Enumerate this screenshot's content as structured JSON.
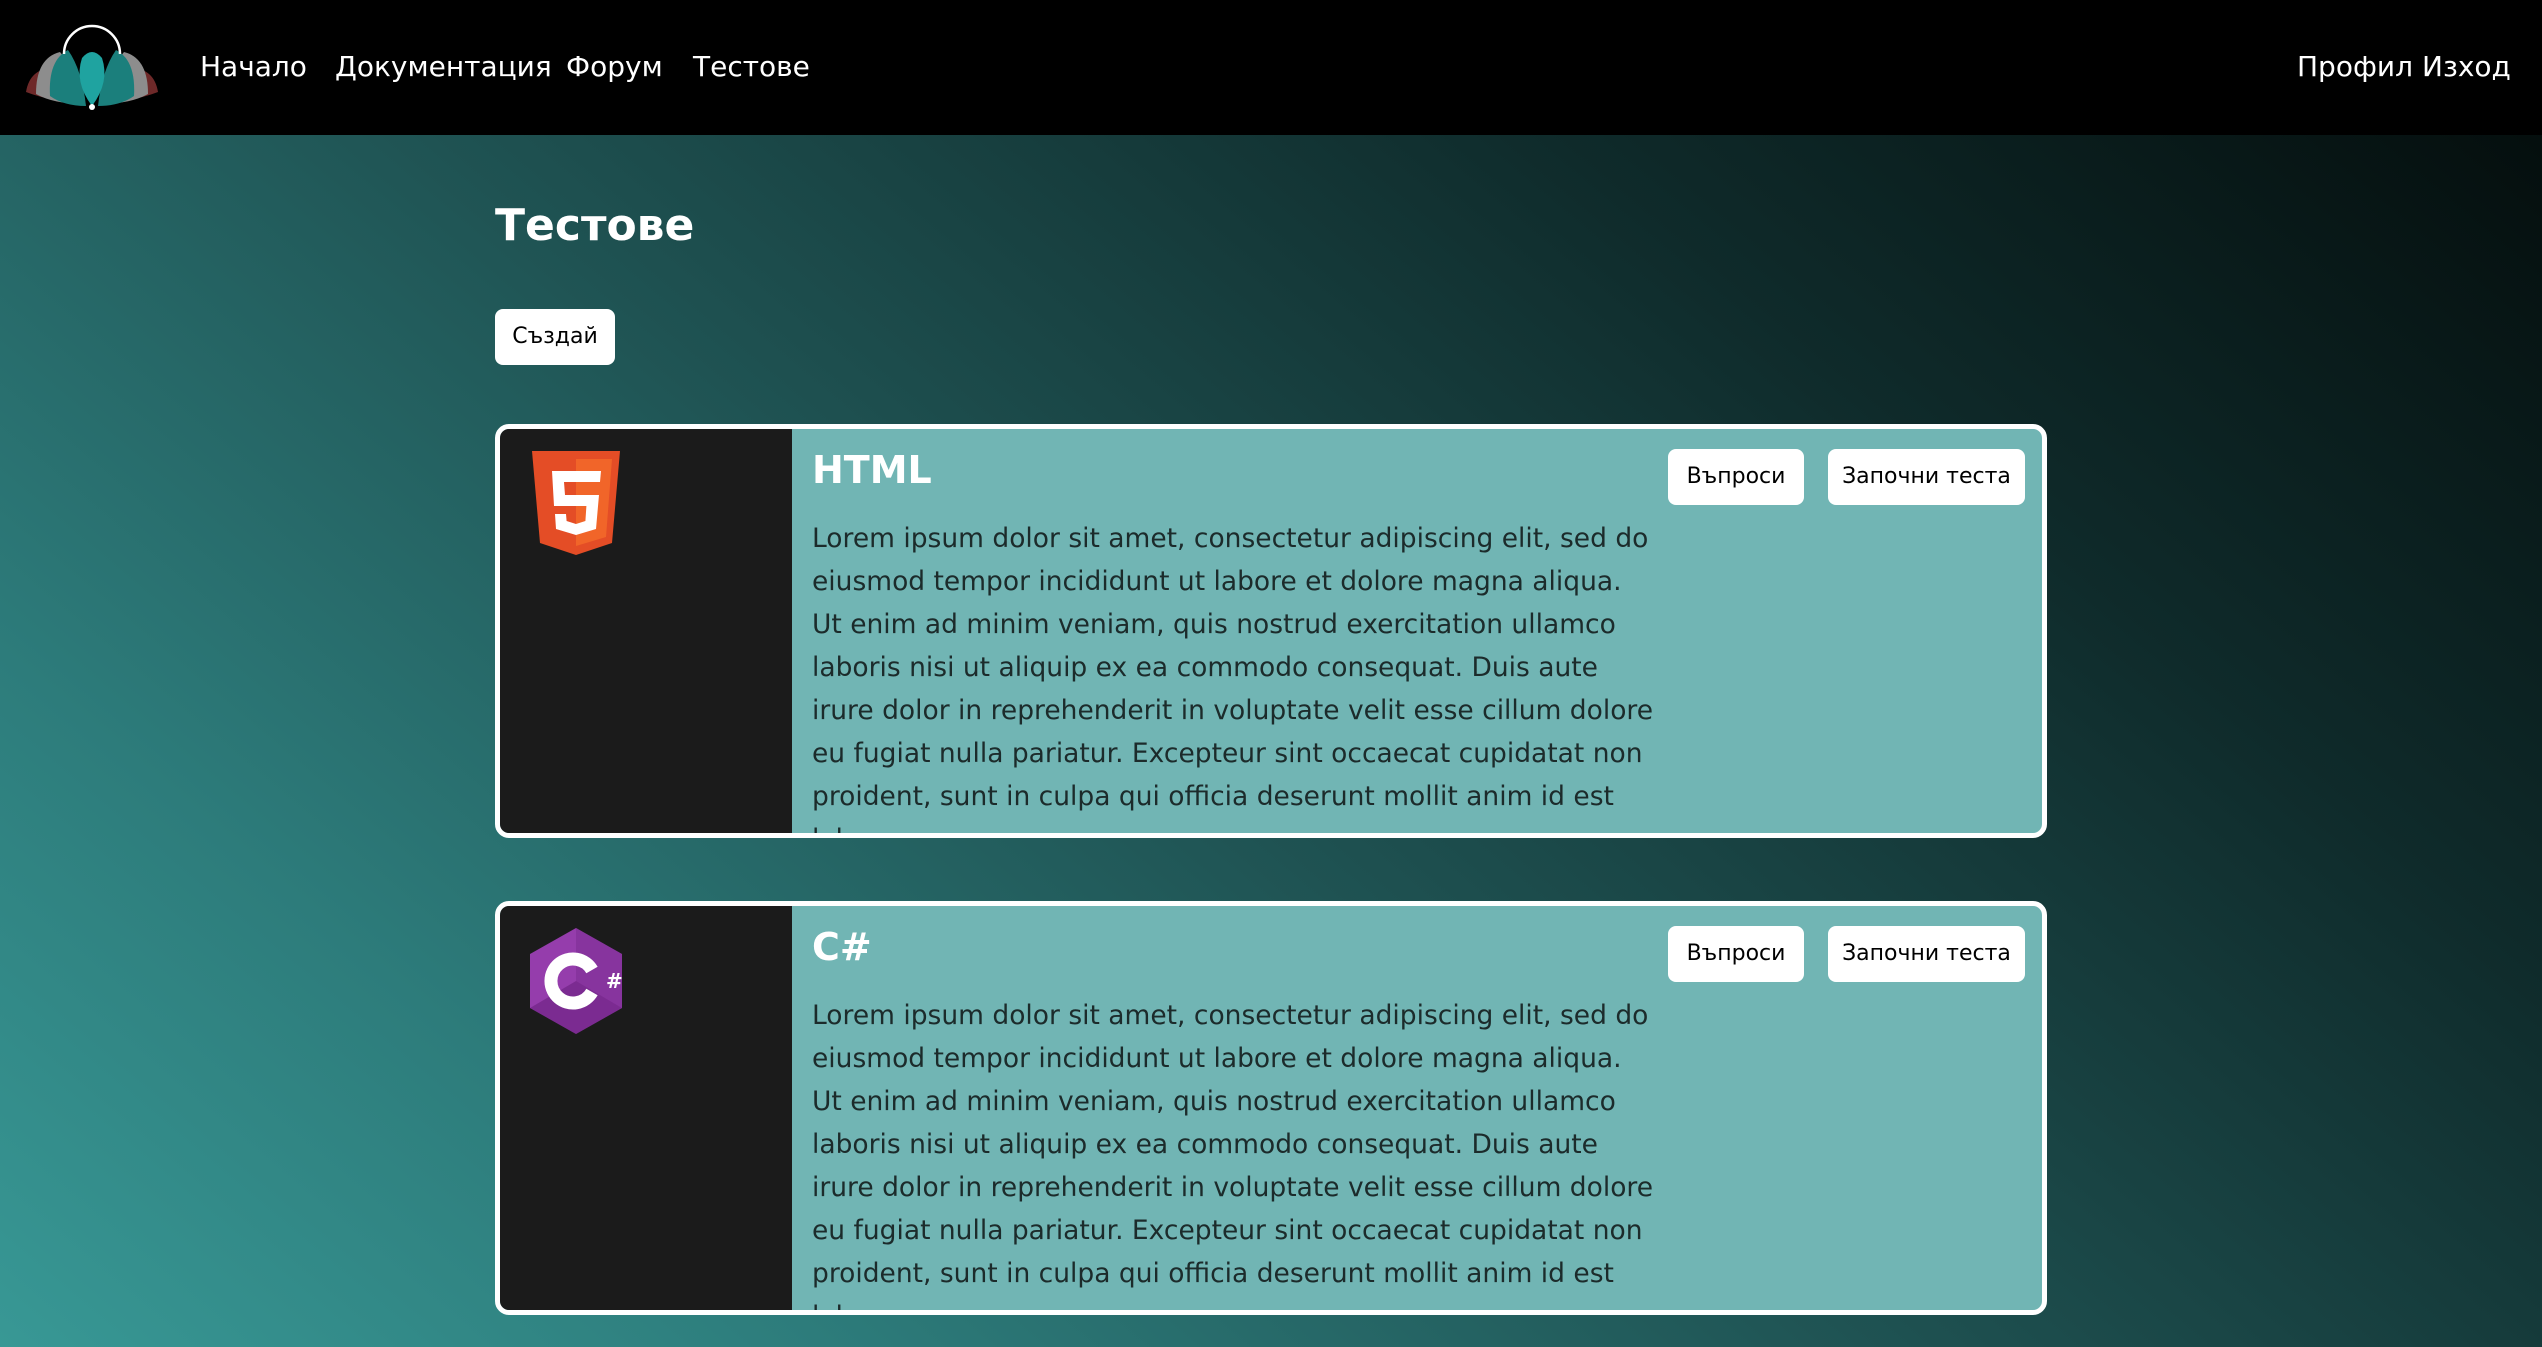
{
  "nav": {
    "logo": "lotus-logo",
    "links": [
      "Начало",
      "Документация",
      "Форум",
      "Тестове"
    ],
    "right": [
      "Профил",
      "Изход"
    ]
  },
  "page": {
    "title": "Тестове",
    "create_label": "Създай"
  },
  "cards": [
    {
      "title": "HTML",
      "icon": "html5-icon",
      "description": "Lorem ipsum dolor sit amet, consectetur adipiscing elit, sed do eiusmod tempor incididunt ut labore et dolore magna aliqua. Ut enim ad minim veniam, quis nostrud exercitation ullamco laboris nisi ut aliquip ex ea commodo consequat. Duis aute irure dolor in reprehenderit in voluptate velit esse cillum dolore eu fugiat nulla pariatur. Excepteur sint occaecat cupidatat non proident, sunt in culpa qui officia deserunt mollit anim id est laborum.",
      "questions_label": "Въпроси",
      "start_label": "Започни теста"
    },
    {
      "title": "C#",
      "icon": "csharp-icon",
      "description": "Lorem ipsum dolor sit amet, consectetur adipiscing elit, sed do eiusmod tempor incididunt ut labore et dolore magna aliqua. Ut enim ad minim veniam, quis nostrud exercitation ullamco laboris nisi ut aliquip ex ea commodo consequat. Duis aute irure dolor in reprehenderit in voluptate velit esse cillum dolore eu fugiat nulla pariatur. Excepteur sint occaecat cupidatat non proident, sunt in culpa qui officia deserunt mollit anim id est laborum.",
      "questions_label": "Въпроси",
      "start_label": "Започни теста"
    }
  ],
  "colors": {
    "navbar": "#000000",
    "card_bg": "#71b5b4",
    "card_side": "#1b1b1b",
    "html5_orange": "#e44d26",
    "csharp_purple": "#953dac"
  }
}
